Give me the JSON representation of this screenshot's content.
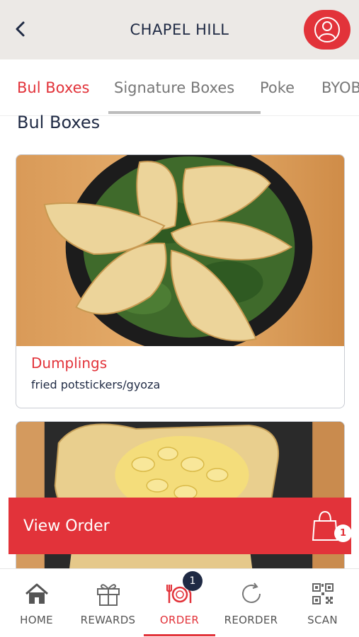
{
  "header": {
    "title": "CHAPEL HILL",
    "back_icon": "chevron-left-icon",
    "profile_icon": "user-icon"
  },
  "tabs": [
    {
      "label": "Bul Boxes",
      "active": true
    },
    {
      "label": "Signature Boxes",
      "active": false
    },
    {
      "label": "Poke",
      "active": false
    },
    {
      "label": "BYOB",
      "active": false
    }
  ],
  "section": {
    "title": "Bul Boxes"
  },
  "items": [
    {
      "name": "Dumplings",
      "description": "fried potstickers/gyoza",
      "image_icon": "dumplings-photo"
    },
    {
      "name": "",
      "description": "",
      "image_icon": "mac-and-cheese-eggroll-photo"
    }
  ],
  "view_order": {
    "label": "View Order",
    "count": "1",
    "icon": "shopping-bag-icon"
  },
  "bottom_nav": [
    {
      "label": "HOME",
      "icon": "home-icon",
      "active": false
    },
    {
      "label": "REWARDS",
      "icon": "gift-icon",
      "active": false
    },
    {
      "label": "ORDER",
      "icon": "plate-cutlery-icon",
      "active": true,
      "badge": "1"
    },
    {
      "label": "REORDER",
      "icon": "refresh-icon",
      "active": false
    },
    {
      "label": "SCAN",
      "icon": "qr-code-icon",
      "active": false
    }
  ],
  "colors": {
    "accent": "#e2333a",
    "navy": "#1f2a44",
    "header_bg": "#ece9e6"
  }
}
